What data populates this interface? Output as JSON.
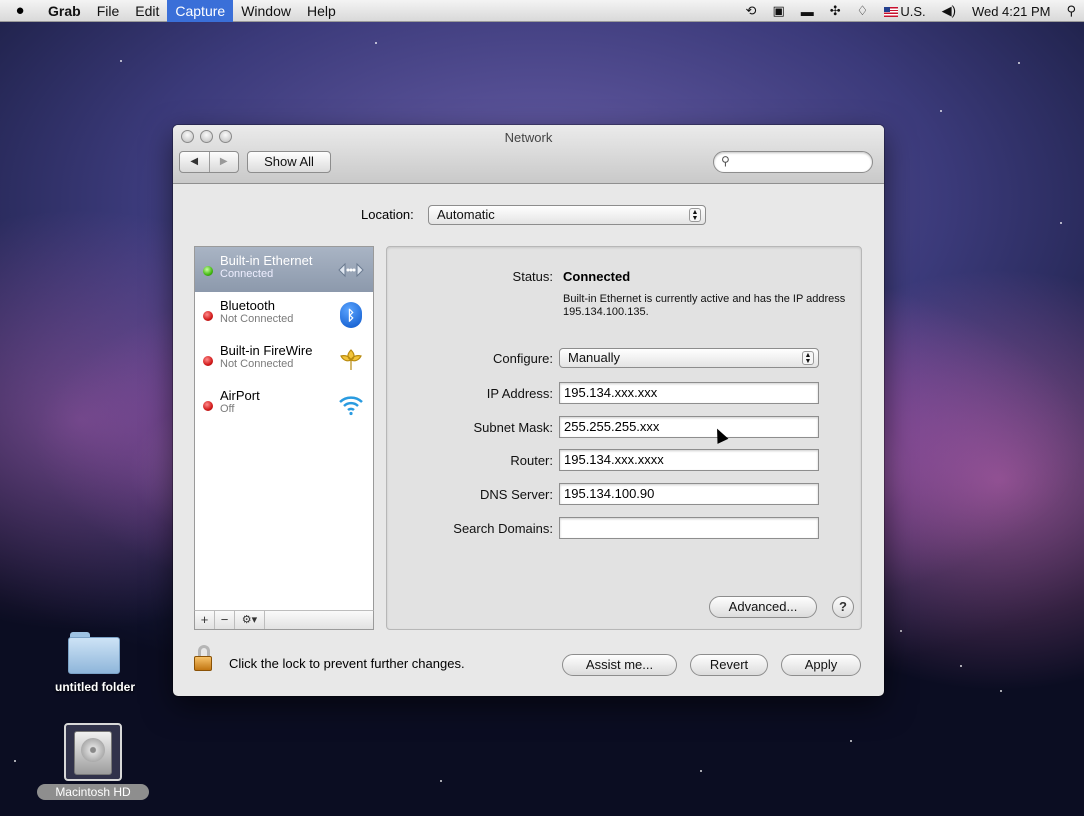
{
  "menubar": {
    "app_name": "Grab",
    "items": [
      "File",
      "Edit",
      "Capture",
      "Window",
      "Help"
    ],
    "active_item": "Capture",
    "input_source": "U.S.",
    "clock": "Wed 4:21 PM"
  },
  "window": {
    "title": "Network",
    "show_all_label": "Show All",
    "search_placeholder": "",
    "location_label": "Location:",
    "location_value": "Automatic"
  },
  "services": [
    {
      "name": "Built-in Ethernet",
      "state": "Connected",
      "status_color": "green",
      "icon": "ethernet-icon",
      "selected": true
    },
    {
      "name": "Bluetooth",
      "state": "Not Connected",
      "status_color": "red",
      "icon": "bluetooth-icon",
      "selected": false
    },
    {
      "name": "Built-in FireWire",
      "state": "Not Connected",
      "status_color": "red",
      "icon": "firewire-icon",
      "selected": false
    },
    {
      "name": "AirPort",
      "state": "Off",
      "status_color": "red",
      "icon": "wifi-icon",
      "selected": false
    }
  ],
  "sidebar_toolbar": {
    "add": "+",
    "remove": "−",
    "gear": "⚙▾"
  },
  "detail": {
    "status_label": "Status:",
    "status_value": "Connected",
    "status_description": "Built-in Ethernet is currently active and has the IP address 195.134.100.135.",
    "configure_label": "Configure:",
    "configure_value": "Manually",
    "ip_label": "IP Address:",
    "ip_value": "195.134.xxx.xxx",
    "subnet_label": "Subnet Mask:",
    "subnet_value": "255.255.255.xxx",
    "router_label": "Router:",
    "router_value": "195.134.xxx.xxxx",
    "dns_label": "DNS Server:",
    "dns_value": "195.134.100.90",
    "search_domains_label": "Search Domains:",
    "search_domains_value": "",
    "advanced_label": "Advanced...",
    "help_label": "?"
  },
  "footer": {
    "lock_text": "Click the lock to prevent further changes.",
    "assist_label": "Assist me...",
    "revert_label": "Revert",
    "apply_label": "Apply"
  },
  "desktop": {
    "folder_label": "untitled folder",
    "disk_label": "Macintosh HD"
  },
  "colors": {
    "menu_highlight": "#3a6fd8",
    "selected_row": "#8c99ac",
    "connected_green": "#41b80f",
    "disconnected_red": "#d11a1a"
  }
}
